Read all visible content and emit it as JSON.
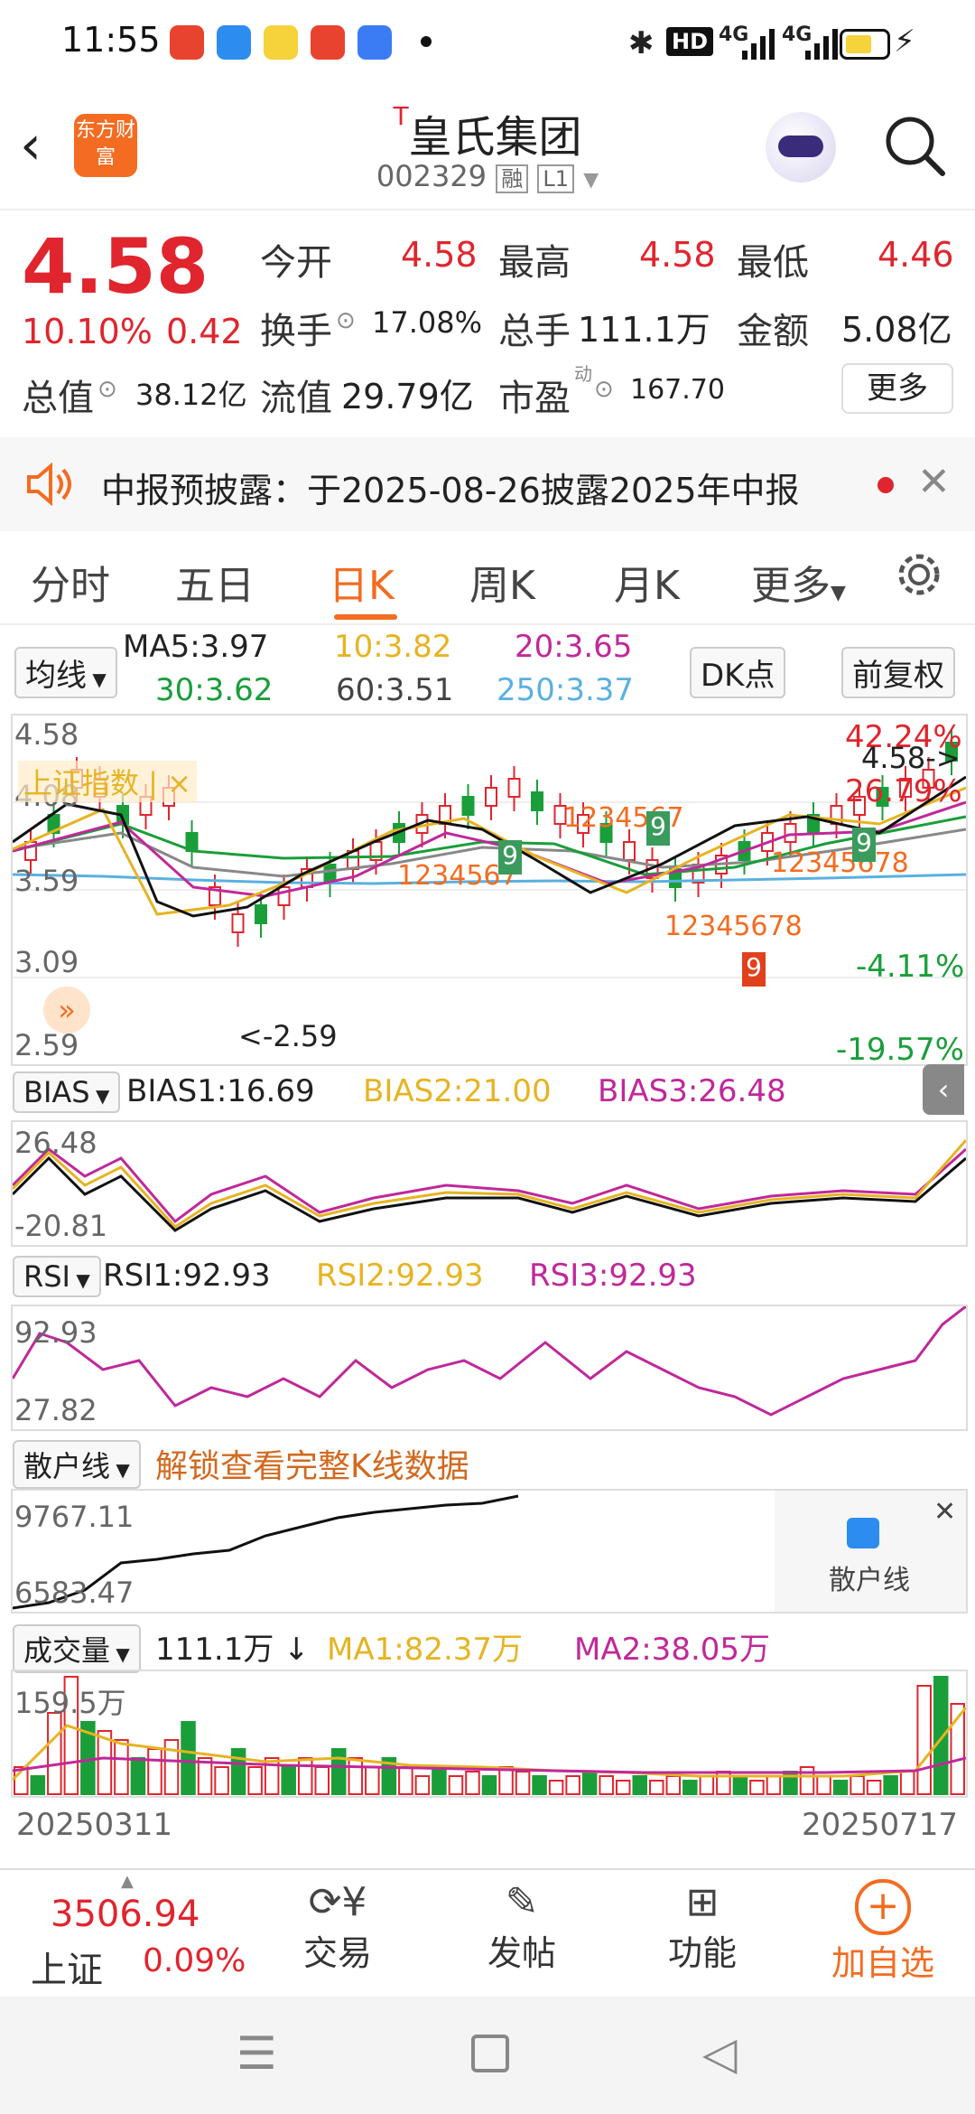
{
  "status_bar": {
    "time": "11:55",
    "hd": "HD",
    "net1": "4G",
    "net2": "4G"
  },
  "header": {
    "brand": "东方财富",
    "title": "皇氏集团",
    "title_prefix": "T",
    "code": "002329",
    "badge_rong": "融",
    "badge_level": "L1"
  },
  "quote": {
    "price": "4.58",
    "change_pct": "10.10%",
    "change": "0.42",
    "open_label": "今开",
    "open": "4.58",
    "high_label": "最高",
    "high": "4.58",
    "low_label": "最低",
    "low": "4.46",
    "turnover_label": "换手",
    "turnover": "17.08%",
    "volume_label": "总手",
    "volume": "111.1万",
    "amount_label": "金额",
    "amount": "5.08亿",
    "total_value_label": "总值",
    "total_value": "38.12亿",
    "float_value_label": "流值",
    "float_value": "29.79亿",
    "pe_label": "市盈",
    "pe_sup": "动",
    "pe": "167.70",
    "more_label": "更多"
  },
  "notice": {
    "text": "中报预披露：于2025-08-26披露2025年中报"
  },
  "tabs": [
    {
      "label": "分时"
    },
    {
      "label": "五日"
    },
    {
      "label": "日K"
    },
    {
      "label": "周K"
    },
    {
      "label": "月K"
    },
    {
      "label": "更多"
    }
  ],
  "ma_bar": {
    "selector": "均线",
    "ma5": "MA5:3.97",
    "ma10": "10:3.82",
    "ma20": "20:3.65",
    "ma30": "30:3.62",
    "ma60": "60:3.51",
    "ma250": "250:3.37",
    "dk_label": "DK点",
    "fq_label": "前复权"
  },
  "main_chart": {
    "y_top": "4.58",
    "y_2": "4.08",
    "y_3": "3.59",
    "y_4": "3.09",
    "y_bottom": "2.59",
    "pct_top": "42.24%",
    "pct_2": "26.79%",
    "pct_3": "-4.11%",
    "pct_bottom": "-19.57%",
    "last_label": "4.58->",
    "low_label": "<-2.59",
    "index_label": "上证指数 | ×"
  },
  "bias": {
    "selector": "BIAS",
    "b1": "BIAS1:16.69",
    "b2": "BIAS2:21.00",
    "b3": "BIAS3:26.48",
    "y_top": "26.48",
    "y_bottom": "-20.81"
  },
  "rsi": {
    "selector": "RSI",
    "r1": "RSI1:92.93",
    "r2": "RSI2:92.93",
    "r3": "RSI3:92.93",
    "y_top": "92.93",
    "y_bottom": "27.82"
  },
  "retail": {
    "selector": "散户线",
    "unlock": "解锁查看完整K线数据",
    "y_top": "9767.11",
    "y_bottom": "6583.47",
    "card_label": "散户线"
  },
  "volume": {
    "selector": "成交量",
    "v": "111.1万",
    "ma1": "MA1:82.37万",
    "ma2": "MA2:38.05万",
    "y_top": "159.5万",
    "date_start": "20250311",
    "date_end": "20250717"
  },
  "bottom_nav": {
    "index_value": "3506.94",
    "index_name": "上证",
    "index_pct": "0.09%",
    "trade": "交易",
    "post": "发帖",
    "func": "功能",
    "add": "加自选"
  },
  "colors": {
    "red": "#e0252e",
    "green": "#1a9e3a",
    "orange": "#f5682a",
    "ma10": "#e6b422",
    "ma20": "#c0289a",
    "ma250": "#5ab0e0"
  }
}
